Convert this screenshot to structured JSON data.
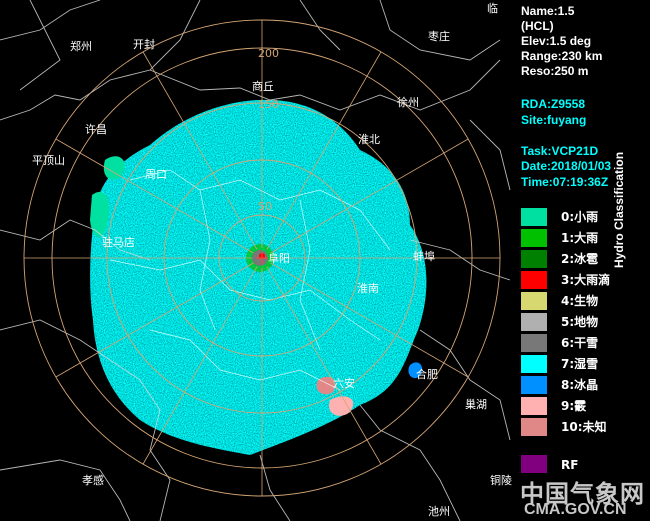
{
  "header": {
    "name": "Name:1.5",
    "product": "(HCL)",
    "elev": "Elev:1.5 deg",
    "range": "Range:230 km",
    "reso": "Reso:250 m"
  },
  "site": {
    "rda": "RDA:Z9558",
    "site": "Site:fuyang",
    "task": "Task:VCP21D",
    "date": "Date:2018/01/03",
    "time": "Time:07:19:36Z"
  },
  "legend": {
    "title": "Hydro Classification",
    "items": [
      {
        "label": "0:小雨",
        "color": "#00e0a0"
      },
      {
        "label": "1:大雨",
        "color": "#00c000"
      },
      {
        "label": "2:冰雹",
        "color": "#008000"
      },
      {
        "label": "3:大雨滴",
        "color": "#ff0000"
      },
      {
        "label": "4:生物",
        "color": "#d8d870"
      },
      {
        "label": "5:地物",
        "color": "#b0b0b0"
      },
      {
        "label": "6:干雪",
        "color": "#787878"
      },
      {
        "label": "7:湿雪",
        "color": "#00ffff"
      },
      {
        "label": "8:冰晶",
        "color": "#0090ff"
      },
      {
        "label": "9:霰",
        "color": "#ffb0b0"
      },
      {
        "label": "10:未知",
        "color": "#e08888"
      }
    ],
    "rf": {
      "label": "RF",
      "color": "#800080"
    }
  },
  "range_labels": [
    "200",
    "150",
    "50"
  ],
  "cities": [
    {
      "name": "临"
    },
    {
      "name": "郑州"
    },
    {
      "name": "开封"
    },
    {
      "name": "商丘"
    },
    {
      "name": "徐州"
    },
    {
      "name": "许昌"
    },
    {
      "name": "淮北"
    },
    {
      "name": "平顶山"
    },
    {
      "name": "周口"
    },
    {
      "name": "驻马店"
    },
    {
      "name": "阜阳"
    },
    {
      "name": "蚌埠"
    },
    {
      "name": "淮南"
    },
    {
      "name": "合肥"
    },
    {
      "name": "六安"
    },
    {
      "name": "巢湖"
    },
    {
      "name": "孝感"
    },
    {
      "name": "铜陵"
    },
    {
      "name": "池州"
    },
    {
      "name": "枣庄"
    }
  ],
  "watermark": {
    "cn": "中国气象网",
    "url": "CMA.GOV.CN"
  }
}
